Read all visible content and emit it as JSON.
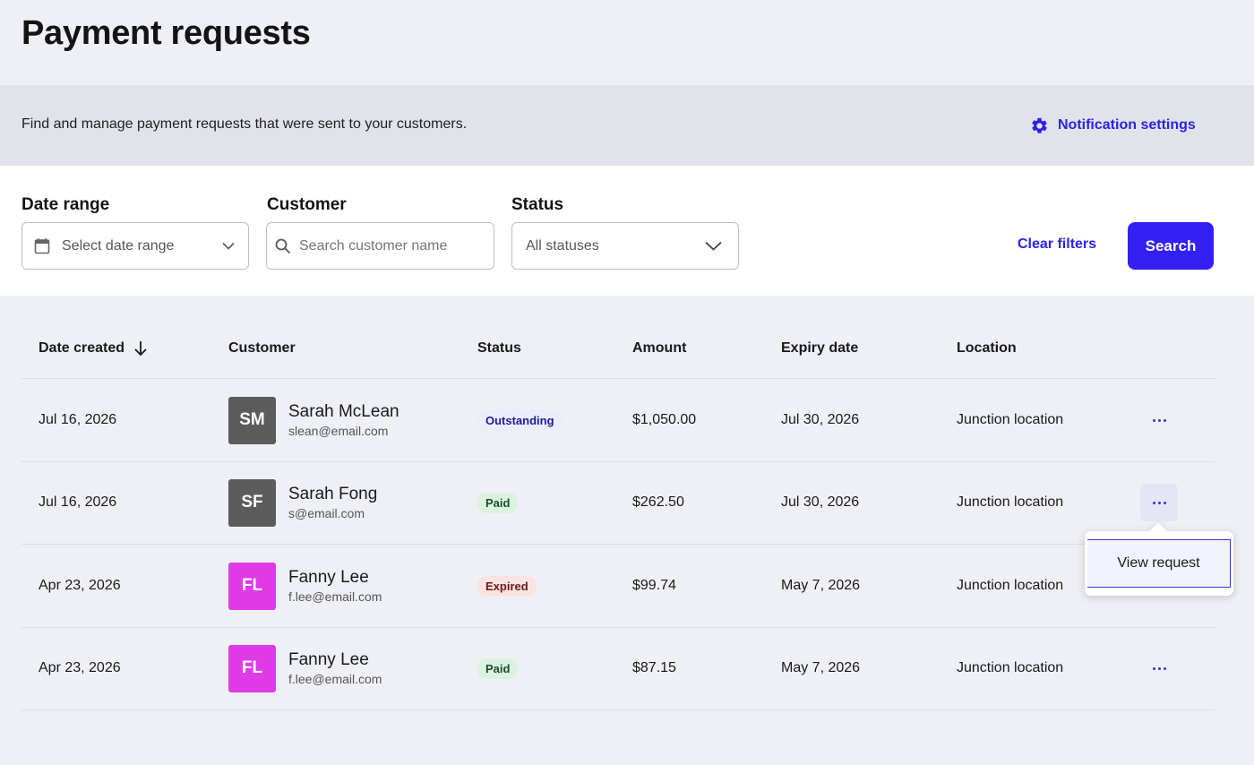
{
  "page_title": "Payment requests",
  "intro": {
    "text": "Find and manage payment requests that were sent to your customers.",
    "notification_link": "Notification settings"
  },
  "filters": {
    "date_range": {
      "label": "Date range",
      "placeholder": "Select date range"
    },
    "customer": {
      "label": "Customer",
      "placeholder": "Search customer name"
    },
    "status": {
      "label": "Status",
      "value": "All statuses"
    },
    "clear_label": "Clear filters",
    "search_label": "Search"
  },
  "table": {
    "columns": {
      "date_created": "Date created",
      "customer": "Customer",
      "status": "Status",
      "amount": "Amount",
      "expiry": "Expiry date",
      "location": "Location"
    },
    "sort_icon": "arrow-down-icon",
    "rows": [
      {
        "date": "Jul 16, 2026",
        "initials": "SM",
        "name": "Sarah McLean",
        "email": "slean@email.com",
        "status": "Outstanding",
        "amount": "$1,050.00",
        "expiry": "Jul 30, 2026",
        "location": "Junction location"
      },
      {
        "date": "Jul 16, 2026",
        "initials": "SF",
        "name": "Sarah Fong",
        "email": "s@email.com",
        "status": "Paid",
        "amount": "$262.50",
        "expiry": "Jul 30, 2026",
        "location": "Junction location"
      },
      {
        "date": "Apr 23, 2026",
        "initials": "FL",
        "name": "Fanny Lee",
        "email": "f.lee@email.com",
        "status": "Expired",
        "amount": "$99.74",
        "expiry": "May 7, 2026",
        "location": "Junction location"
      },
      {
        "date": "Apr 23, 2026",
        "initials": "FL",
        "name": "Fanny Lee",
        "email": "f.lee@email.com",
        "status": "Paid",
        "amount": "$87.15",
        "expiry": "May 7, 2026",
        "location": "Junction location"
      }
    ]
  },
  "row_menu": {
    "item": "View request"
  },
  "colors": {
    "accent": "#3320f5",
    "link": "#2c23e6",
    "avatar_gray": "#5c5c5c",
    "avatar_magenta": "#e03ae8",
    "badge_outstanding_bg": "#ebedfb",
    "badge_outstanding_fg": "#1f1a9c",
    "badge_paid_bg": "#dcf2e1",
    "badge_paid_fg": "#1b4d2a",
    "badge_expired_bg": "#fbe3e3",
    "badge_expired_fg": "#6b1a1a"
  },
  "icons": {
    "notification": "gear-icon",
    "date": "calendar-icon",
    "customer": "search-icon",
    "dropdown": "chevron-down-icon",
    "row_actions": "more-horizontal-icon"
  }
}
